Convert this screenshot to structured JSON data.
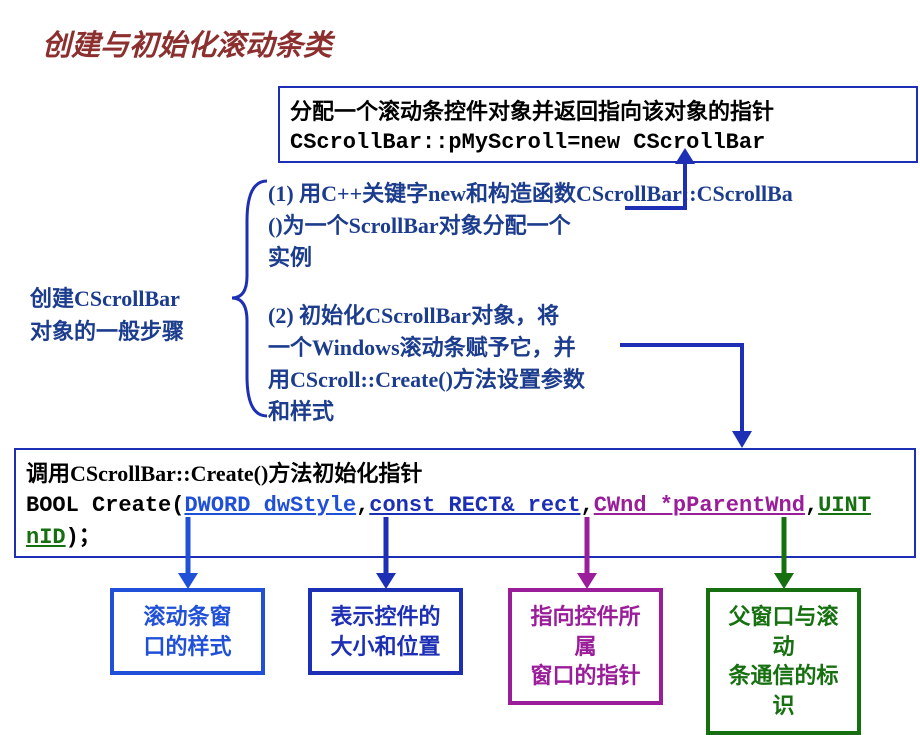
{
  "title": "创建与初始化滚动条类",
  "box1": {
    "line1": "分配一个滚动条控件对象并返回指向该对象的指针",
    "line2": "CScrollBar::pMyScroll=new CScrollBar"
  },
  "left_label": {
    "l1": "创建CScrollBar",
    "l2": "对象的一般步骤"
  },
  "step1": {
    "l1a": "(1) 用C++关键字new和构造函数CScrollBar::CScrollBa",
    "l2": "()为一个ScrollBar对象分配一个",
    "l3": "实例"
  },
  "step2": {
    "l1": "(2) 初始化CScrollBar对象，将",
    "l2": "一个Windows滚动条赋予它，并",
    "l3": "用CScroll::Create()方法设置参数",
    "l4": "和样式"
  },
  "box2": {
    "line1": "调用CScrollBar::Create()方法初始化指针",
    "prefix": "BOOL Create(",
    "p1": "DWORD dwStyle",
    "p2": "const RECT& rect",
    "p3": "CWnd *pParentWnd",
    "p4": "UINT nID"
  },
  "bottom": {
    "b1": {
      "l1": "滚动条窗",
      "l2": "口的样式"
    },
    "b2": {
      "l1": "表示控件的",
      "l2": "大小和位置"
    },
    "b3": {
      "l1": "指向控件所属",
      "l2": "窗口的指针"
    },
    "b4": {
      "l1": "父窗口与滚动",
      "l2": "条通信的标识"
    }
  }
}
